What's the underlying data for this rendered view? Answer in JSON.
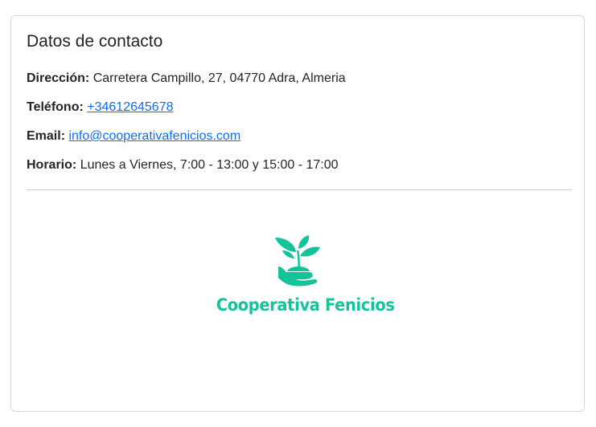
{
  "card": {
    "title": "Datos de contacto",
    "address": {
      "label": "Dirección:",
      "value": "Carretera Campillo, 27, 04770 Adra, Almeria"
    },
    "phone": {
      "label": "Teléfono:",
      "value": "+34612645678"
    },
    "email": {
      "label": "Email:",
      "value": "info@cooperativafenicios.com"
    },
    "hours": {
      "label": "Horario:",
      "value": "Lunes a Viernes, 7:00 - 13:00 y 15:00 - 17:00"
    }
  },
  "logo": {
    "text": "Cooperativa Fenicios",
    "icon": "plant-in-hand-icon",
    "color": "#15c39a"
  },
  "colors": {
    "link": "#0d6efd",
    "border": "#d6d8db",
    "text": "#212529"
  }
}
